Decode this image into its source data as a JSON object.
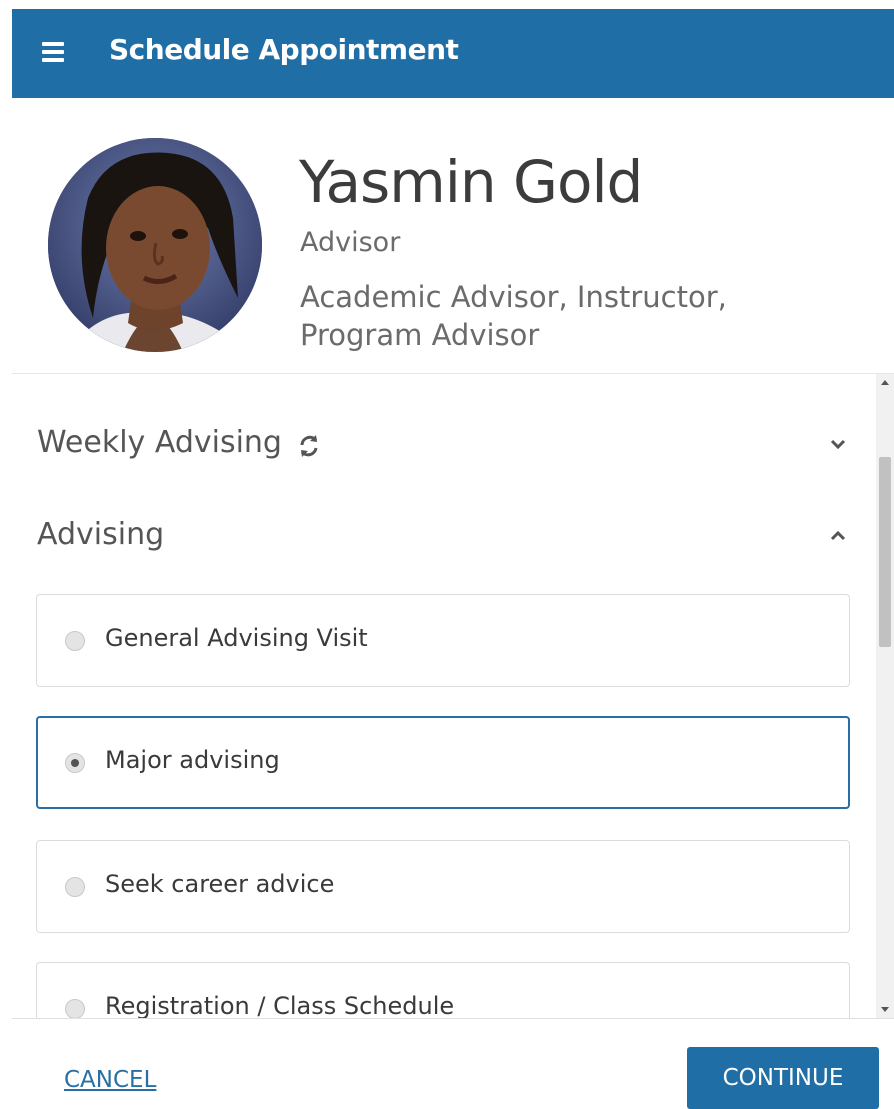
{
  "header": {
    "title": "Schedule Appointment",
    "menu_icon": "hamburger-menu-icon",
    "background": "#1f6ea6"
  },
  "profile": {
    "name": "Yasmin Gold",
    "role": "Advisor",
    "roles_list": "Academic Advisor, Instructor, Program Advisor"
  },
  "sections": [
    {
      "title": "Weekly Advising",
      "icon": "sync-icon",
      "expanded": false
    },
    {
      "title": "Advising",
      "expanded": true
    }
  ],
  "options": [
    {
      "label": "General Advising Visit",
      "selected": false
    },
    {
      "label": "Major advising",
      "selected": true
    },
    {
      "label": "Seek career advice",
      "selected": false
    },
    {
      "label": "Registration / Class Schedule",
      "selected": false
    }
  ],
  "footer": {
    "cancel_label": "CANCEL",
    "continue_label": "CONTINUE"
  },
  "colors": {
    "accent": "#1f6ea6",
    "selected_border": "#2a6fa3"
  }
}
